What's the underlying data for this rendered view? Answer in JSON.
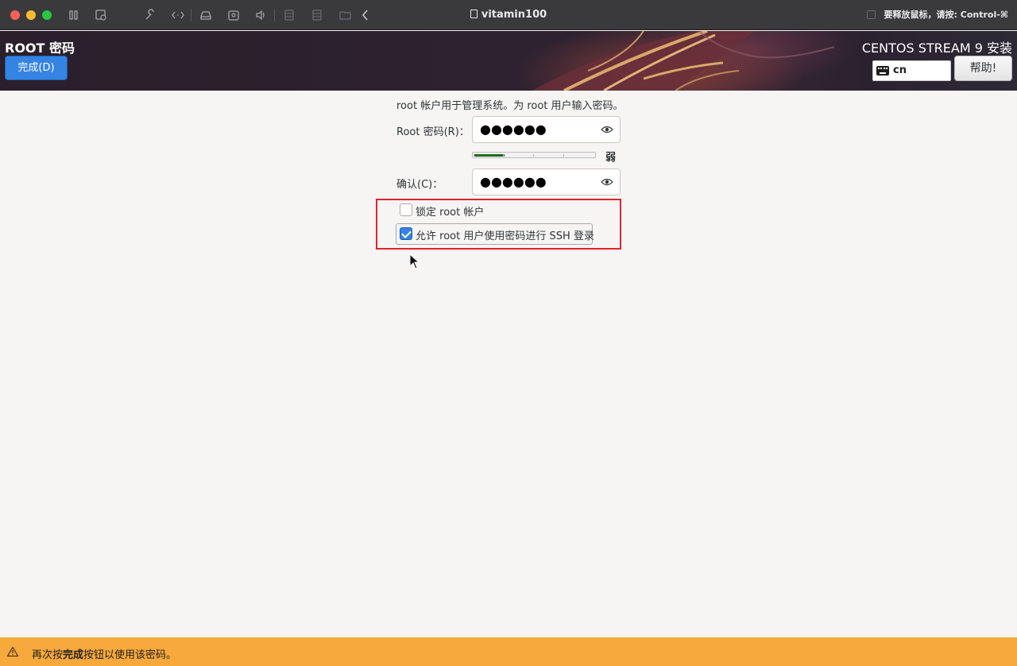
{
  "window": {
    "title": "vitamin100",
    "release_hint": "要释放鼠标，请按: Control-⌘",
    "toolbar_icons": [
      "pause-icon",
      "snapshot-icon",
      "wrench-icon",
      "code-icon",
      "disk-icon",
      "camera-icon",
      "sound-icon",
      "usb-icon",
      "drive-icon",
      "folder-icon",
      "chevron-left-icon",
      "copy-icon"
    ]
  },
  "header": {
    "spoke_title": "ROOT 密码",
    "done_label": "完成(D)",
    "product_title": "CENTOS STREAM 9 安装",
    "keyboard_layout": "cn",
    "help_label": "帮助!"
  },
  "form": {
    "intro": "root 帐户用于管理系统。为 root 用户输入密码。",
    "password_label": "Root 密码(R)：",
    "password_mask": "●●●●●●",
    "strength_label": "弱",
    "strength_fraction": 0.25,
    "confirm_label": "确认(C)：",
    "confirm_mask": "●●●●●●",
    "lock_root_label": "锁定 root 帐户",
    "lock_root_checked": false,
    "allow_ssh_label": "允许 root 用户使用密码进行 SSH 登录",
    "allow_ssh_checked": true
  },
  "footer": {
    "prefix": "再次按",
    "bold": "完成",
    "suffix": "按钮以使用该密码。"
  },
  "colors": {
    "accent": "#3584e4",
    "warning_bar": "#f8a93b",
    "highlight_box": "#e0242e",
    "strength_weak": "#1e6b1e"
  }
}
